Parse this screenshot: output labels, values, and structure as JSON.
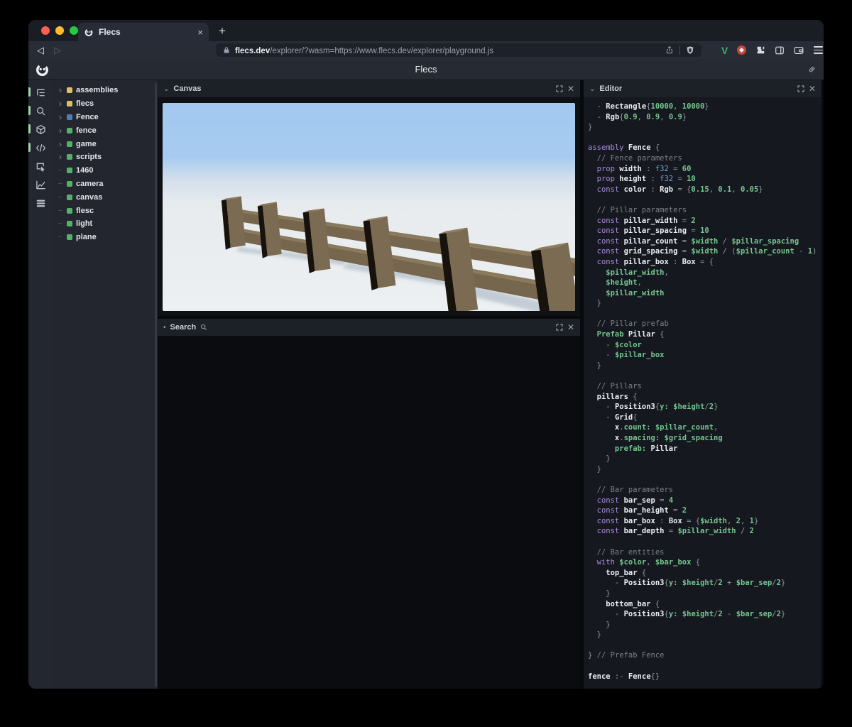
{
  "browser": {
    "tab": {
      "title": "Flecs",
      "close_label": "×",
      "new_tab_label": "+"
    },
    "nav": {
      "back": "◁",
      "forward": "▷"
    },
    "url": {
      "domain": "flecs.dev",
      "path": "/explorer/?wasm=https://www.flecs.dev/explorer/playground.js"
    },
    "extension_icons": [
      "vue-devtools-icon",
      "red-badge-icon",
      "puzzle-extensions-icon",
      "side-panel-icon",
      "wallet-icon",
      "menu-icon"
    ]
  },
  "app": {
    "title": "Flecs",
    "colors": {
      "accent_green": "#9ed8ae",
      "entity_yellow": "#d9c163",
      "entity_blue": "#4e7dbb",
      "entity_green": "#54b16a",
      "sky": "#a7cbf0",
      "ground": "#edf0f2",
      "wood_light": "#857455",
      "wood_front": "#76664d",
      "wood_dark": "#16120b",
      "shadow": "#a8b6c4"
    }
  },
  "sidebar": {
    "icons": [
      {
        "name": "entity-tree-icon",
        "active": true
      },
      {
        "name": "search-icon",
        "active": true
      },
      {
        "name": "entities-cube-icon",
        "active": true
      },
      {
        "name": "script-code-icon",
        "active": true
      },
      {
        "name": "inspect-icon",
        "active": false
      },
      {
        "name": "statistics-chart-icon",
        "active": false
      },
      {
        "name": "queries-list-icon",
        "active": false
      }
    ]
  },
  "tree": {
    "items": [
      {
        "label": "assemblies",
        "color": "#d9c163",
        "expandable": true
      },
      {
        "label": "flecs",
        "color": "#d9c163",
        "expandable": true
      },
      {
        "label": "Fence",
        "color": "#4e7dbb",
        "expandable": true
      },
      {
        "label": "fence",
        "color": "#54b16a",
        "expandable": true
      },
      {
        "label": "game",
        "color": "#54b16a",
        "expandable": true
      },
      {
        "label": "scripts",
        "color": "#54b16a",
        "expandable": true
      },
      {
        "label": "1460",
        "color": "#54b16a",
        "expandable": false
      },
      {
        "label": "camera",
        "color": "#54b16a",
        "expandable": false
      },
      {
        "label": "canvas",
        "color": "#54b16a",
        "expandable": false
      },
      {
        "label": "flesc",
        "color": "#54b16a",
        "expandable": false
      },
      {
        "label": "light",
        "color": "#54b16a",
        "expandable": false
      },
      {
        "label": "plane",
        "color": "#54b16a",
        "expandable": false
      }
    ]
  },
  "canvas_panel": {
    "title": "Canvas",
    "collapse_mark": "⌄"
  },
  "search_panel": {
    "title": "Search",
    "collapse_mark": "•"
  },
  "editor_panel": {
    "title": "Editor",
    "collapse_mark": "⌄",
    "code_lines": [
      [
        [
          "p",
          "  - "
        ],
        [
          "b",
          "Rectangle"
        ],
        [
          "p",
          "{"
        ],
        [
          "g",
          "10000"
        ],
        [
          "p",
          ", "
        ],
        [
          "g",
          "10000"
        ],
        [
          "p",
          "}"
        ]
      ],
      [
        [
          "p",
          "  - "
        ],
        [
          "b",
          "Rgb"
        ],
        [
          "p",
          "{"
        ],
        [
          "g",
          "0.9"
        ],
        [
          "p",
          ", "
        ],
        [
          "g",
          "0.9"
        ],
        [
          "p",
          ", "
        ],
        [
          "g",
          "0.9"
        ],
        [
          "p",
          "}"
        ]
      ],
      [
        [
          "p",
          "}"
        ]
      ],
      [],
      [
        [
          "k",
          "assembly "
        ],
        [
          "b",
          "Fence"
        ],
        [
          "p",
          " {"
        ]
      ],
      [
        [
          "c",
          "  // Fence parameters"
        ]
      ],
      [
        [
          "k",
          "  prop "
        ],
        [
          "b",
          "width"
        ],
        [
          "p",
          " : "
        ],
        [
          "t",
          "f32"
        ],
        [
          "p",
          " = "
        ],
        [
          "g",
          "60"
        ]
      ],
      [
        [
          "k",
          "  prop "
        ],
        [
          "b",
          "height"
        ],
        [
          "p",
          " : "
        ],
        [
          "t",
          "f32"
        ],
        [
          "p",
          " = "
        ],
        [
          "g",
          "10"
        ]
      ],
      [
        [
          "k",
          "  const "
        ],
        [
          "b",
          "color"
        ],
        [
          "p",
          " : "
        ],
        [
          "b",
          "Rgb"
        ],
        [
          "p",
          " = {"
        ],
        [
          "g",
          "0.15"
        ],
        [
          "p",
          ", "
        ],
        [
          "g",
          "0.1"
        ],
        [
          "p",
          ", "
        ],
        [
          "g",
          "0.05"
        ],
        [
          "p",
          "}"
        ]
      ],
      [],
      [
        [
          "c",
          "  // Pillar parameters"
        ]
      ],
      [
        [
          "k",
          "  const "
        ],
        [
          "b",
          "pillar_width"
        ],
        [
          "p",
          " = "
        ],
        [
          "g",
          "2"
        ]
      ],
      [
        [
          "k",
          "  const "
        ],
        [
          "b",
          "pillar_spacing"
        ],
        [
          "p",
          " = "
        ],
        [
          "g",
          "10"
        ]
      ],
      [
        [
          "k",
          "  const "
        ],
        [
          "b",
          "pillar_count"
        ],
        [
          "p",
          " = "
        ],
        [
          "g",
          "$width"
        ],
        [
          "p",
          " / "
        ],
        [
          "g",
          "$pillar_spacing"
        ]
      ],
      [
        [
          "k",
          "  const "
        ],
        [
          "b",
          "grid_spacing"
        ],
        [
          "p",
          " = "
        ],
        [
          "g",
          "$width"
        ],
        [
          "p",
          " / ("
        ],
        [
          "g",
          "$pillar_count"
        ],
        [
          "p",
          " - "
        ],
        [
          "g",
          "1"
        ],
        [
          "p",
          ")"
        ]
      ],
      [
        [
          "k",
          "  const "
        ],
        [
          "b",
          "pillar_box"
        ],
        [
          "p",
          " : "
        ],
        [
          "b",
          "Box"
        ],
        [
          "p",
          " = {"
        ]
      ],
      [
        [
          "g",
          "    $pillar_width"
        ],
        [
          "p",
          ","
        ]
      ],
      [
        [
          "g",
          "    $height"
        ],
        [
          "p",
          ","
        ]
      ],
      [
        [
          "g",
          "    $pillar_width"
        ]
      ],
      [
        [
          "p",
          "  }"
        ]
      ],
      [],
      [
        [
          "c",
          "  // Pillar prefab"
        ]
      ],
      [
        [
          "g",
          "  Prefab "
        ],
        [
          "b",
          "Pillar"
        ],
        [
          "p",
          " {"
        ]
      ],
      [
        [
          "p",
          "    - "
        ],
        [
          "g",
          "$color"
        ]
      ],
      [
        [
          "p",
          "    - "
        ],
        [
          "g",
          "$pillar_box"
        ]
      ],
      [
        [
          "p",
          "  }"
        ]
      ],
      [],
      [
        [
          "c",
          "  // Pillars"
        ]
      ],
      [
        [
          "b",
          "  pillars"
        ],
        [
          "p",
          " {"
        ]
      ],
      [
        [
          "p",
          "    - "
        ],
        [
          "b",
          "Position3"
        ],
        [
          "p",
          "{"
        ],
        [
          "g",
          "y:"
        ],
        [
          "p",
          " "
        ],
        [
          "g",
          "$height"
        ],
        [
          "p",
          "/"
        ],
        [
          "g",
          "2"
        ],
        [
          "p",
          "}"
        ]
      ],
      [
        [
          "p",
          "    - "
        ],
        [
          "b",
          "Grid"
        ],
        [
          "p",
          "{"
        ]
      ],
      [
        [
          "b",
          "      x"
        ],
        [
          "p",
          "."
        ],
        [
          "g",
          "count:"
        ],
        [
          "p",
          " "
        ],
        [
          "g",
          "$pillar_count"
        ],
        [
          "p",
          ","
        ]
      ],
      [
        [
          "b",
          "      x"
        ],
        [
          "p",
          "."
        ],
        [
          "g",
          "spacing:"
        ],
        [
          "p",
          " "
        ],
        [
          "g",
          "$grid_spacing"
        ]
      ],
      [
        [
          "g",
          "      prefab:"
        ],
        [
          "p",
          " "
        ],
        [
          "b",
          "Pillar"
        ]
      ],
      [
        [
          "p",
          "    }"
        ]
      ],
      [
        [
          "p",
          "  }"
        ]
      ],
      [],
      [
        [
          "c",
          "  // Bar parameters"
        ]
      ],
      [
        [
          "k",
          "  const "
        ],
        [
          "b",
          "bar_sep"
        ],
        [
          "p",
          " = "
        ],
        [
          "g",
          "4"
        ]
      ],
      [
        [
          "k",
          "  const "
        ],
        [
          "b",
          "bar_height"
        ],
        [
          "p",
          " = "
        ],
        [
          "g",
          "2"
        ]
      ],
      [
        [
          "k",
          "  const "
        ],
        [
          "b",
          "bar_box"
        ],
        [
          "p",
          " : "
        ],
        [
          "b",
          "Box"
        ],
        [
          "p",
          " = {"
        ],
        [
          "g",
          "$width"
        ],
        [
          "p",
          ", "
        ],
        [
          "g",
          "2"
        ],
        [
          "p",
          ", "
        ],
        [
          "g",
          "1"
        ],
        [
          "p",
          "}"
        ]
      ],
      [
        [
          "k",
          "  const "
        ],
        [
          "b",
          "bar_depth"
        ],
        [
          "p",
          " = "
        ],
        [
          "g",
          "$pillar_width"
        ],
        [
          "p",
          " / "
        ],
        [
          "g",
          "2"
        ]
      ],
      [],
      [
        [
          "c",
          "  // Bar entities"
        ]
      ],
      [
        [
          "k",
          "  with "
        ],
        [
          "g",
          "$color"
        ],
        [
          "p",
          ", "
        ],
        [
          "g",
          "$bar_box"
        ],
        [
          "p",
          " {"
        ]
      ],
      [
        [
          "b",
          "    top_bar"
        ],
        [
          "p",
          " {"
        ]
      ],
      [
        [
          "p",
          "      - "
        ],
        [
          "b",
          "Position3"
        ],
        [
          "p",
          "{"
        ],
        [
          "g",
          "y:"
        ],
        [
          "p",
          " "
        ],
        [
          "g",
          "$height"
        ],
        [
          "p",
          "/"
        ],
        [
          "g",
          "2"
        ],
        [
          "p",
          " + "
        ],
        [
          "g",
          "$bar_sep"
        ],
        [
          "p",
          "/"
        ],
        [
          "g",
          "2"
        ],
        [
          "p",
          "}"
        ]
      ],
      [
        [
          "p",
          "    }"
        ]
      ],
      [
        [
          "b",
          "    bottom_bar"
        ],
        [
          "p",
          " {"
        ]
      ],
      [
        [
          "p",
          "      - "
        ],
        [
          "b",
          "Position3"
        ],
        [
          "p",
          "{"
        ],
        [
          "g",
          "y:"
        ],
        [
          "p",
          " "
        ],
        [
          "g",
          "$height"
        ],
        [
          "p",
          "/"
        ],
        [
          "g",
          "2"
        ],
        [
          "p",
          " - "
        ],
        [
          "g",
          "$bar_sep"
        ],
        [
          "p",
          "/"
        ],
        [
          "g",
          "2"
        ],
        [
          "p",
          "}"
        ]
      ],
      [
        [
          "p",
          "    }"
        ]
      ],
      [
        [
          "p",
          "  }"
        ]
      ],
      [],
      [
        [
          "p",
          "} "
        ],
        [
          "c",
          "// Prefab Fence"
        ]
      ],
      [],
      [
        [
          "b",
          "fence"
        ],
        [
          "p",
          " :- "
        ],
        [
          "b",
          "Fence"
        ],
        [
          "p",
          "{}"
        ]
      ]
    ]
  }
}
